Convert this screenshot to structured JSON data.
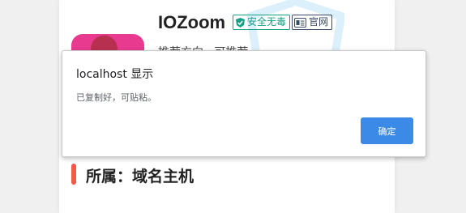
{
  "app": {
    "title": "IOZoom",
    "badge_safe": "安全无毒",
    "badge_official": "官网",
    "subtitle_peek": "推荐方向 · 可推荐"
  },
  "section": {
    "title": "所属：域名主机"
  },
  "dialog": {
    "title": "localhost 显示",
    "message": "已复制好，可贴粘。",
    "ok_label": "确定"
  },
  "colors": {
    "accent_button": "#3c8ae8",
    "safe_badge": "#16a085",
    "section_marker": "#f15a4a"
  },
  "icons": {
    "safe": "shield-check-icon",
    "official": "id-card-icon"
  }
}
